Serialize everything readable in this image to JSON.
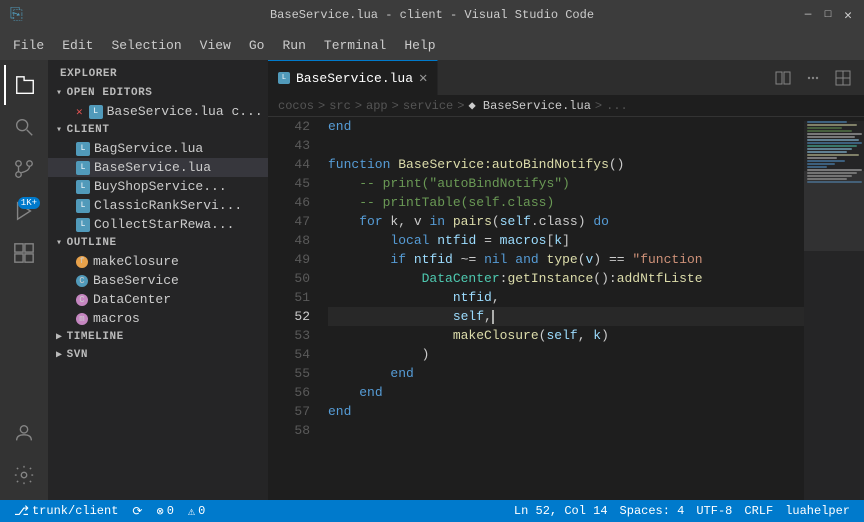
{
  "window": {
    "title": "BaseService.lua - client - Visual Studio Code"
  },
  "menu": {
    "items": [
      "File",
      "Edit",
      "Selection",
      "View",
      "Go",
      "Run",
      "Terminal",
      "Help"
    ]
  },
  "tabs": [
    {
      "label": "BaseService.lua",
      "active": true,
      "modified": false
    }
  ],
  "breadcrumb": {
    "parts": [
      "cocos",
      "src",
      "app",
      "service",
      "BaseService.lua",
      "..."
    ]
  },
  "sidebar": {
    "explorer_title": "EXPLORER",
    "open_editors": {
      "title": "OPEN EDITORS",
      "files": [
        "BaseService.lua  c..."
      ]
    },
    "client": {
      "title": "CLIENT",
      "files": [
        "BagService.lua",
        "BaseService.lua",
        "BuyShopService...",
        "ClassicRankServi...",
        "CollectStarRewa..."
      ]
    },
    "outline": {
      "title": "OUTLINE",
      "items": [
        {
          "name": "makeClosure",
          "type": "fn"
        },
        {
          "name": "BaseService",
          "type": "cls"
        },
        {
          "name": "DataCenter",
          "type": "cls"
        },
        {
          "name": "macros",
          "type": "var"
        }
      ]
    },
    "timeline": "TIMELINE",
    "svn": "SVN"
  },
  "code": {
    "lines": [
      {
        "num": 42,
        "content": "end",
        "tokens": [
          {
            "t": "kw",
            "v": "end"
          }
        ]
      },
      {
        "num": 43,
        "content": "",
        "tokens": []
      },
      {
        "num": 44,
        "content": "function BaseService:autoBindNotifys()",
        "tokens": [
          {
            "t": "kw",
            "v": "function"
          },
          {
            "t": "plain",
            "v": " "
          },
          {
            "t": "fn",
            "v": "BaseService:autoBindNotifys"
          },
          {
            "t": "punc",
            "v": "()"
          }
        ]
      },
      {
        "num": 45,
        "content": "    -- print(\"autoBindNotifys\")",
        "tokens": [
          {
            "t": "plain",
            "v": "    "
          },
          {
            "t": "cm",
            "v": "-- print(\"autoBindNotifys\")"
          }
        ]
      },
      {
        "num": 46,
        "content": "    -- printTable(self.class)",
        "tokens": [
          {
            "t": "plain",
            "v": "    "
          },
          {
            "t": "cm",
            "v": "-- printTable(self.class)"
          }
        ]
      },
      {
        "num": 47,
        "content": "    for k, v in pairs(self.class) do",
        "tokens": [
          {
            "t": "plain",
            "v": "    "
          },
          {
            "t": "kw",
            "v": "for"
          },
          {
            "t": "plain",
            "v": " k, v "
          },
          {
            "t": "kw",
            "v": "in"
          },
          {
            "t": "plain",
            "v": " "
          },
          {
            "t": "fn",
            "v": "pairs"
          },
          {
            "t": "punc",
            "v": "("
          },
          {
            "t": "var",
            "v": "self"
          },
          {
            "t": "plain",
            "v": ".class) "
          },
          {
            "t": "kw",
            "v": "do"
          }
        ]
      },
      {
        "num": 48,
        "content": "        local ntfid = macros[k]",
        "tokens": [
          {
            "t": "plain",
            "v": "        "
          },
          {
            "t": "kw",
            "v": "local"
          },
          {
            "t": "plain",
            "v": " "
          },
          {
            "t": "var",
            "v": "ntfid"
          },
          {
            "t": "plain",
            "v": " = "
          },
          {
            "t": "var",
            "v": "macros"
          },
          {
            "t": "punc",
            "v": "["
          },
          {
            "t": "var",
            "v": "k"
          },
          {
            "t": "punc",
            "v": "]"
          }
        ]
      },
      {
        "num": 49,
        "content": "        if ntfid ~= nil and type(v) == \"function\"",
        "tokens": [
          {
            "t": "plain",
            "v": "        "
          },
          {
            "t": "kw",
            "v": "if"
          },
          {
            "t": "plain",
            "v": " "
          },
          {
            "t": "var",
            "v": "ntfid"
          },
          {
            "t": "plain",
            "v": " ~= "
          },
          {
            "t": "kw",
            "v": "nil"
          },
          {
            "t": "plain",
            "v": " "
          },
          {
            "t": "kw",
            "v": "and"
          },
          {
            "t": "plain",
            "v": " "
          },
          {
            "t": "fn",
            "v": "type"
          },
          {
            "t": "punc",
            "v": "("
          },
          {
            "t": "var",
            "v": "v"
          },
          {
            "t": "punc",
            "v": ")"
          },
          {
            "t": "plain",
            "v": " == "
          },
          {
            "t": "str",
            "v": "\"function\""
          }
        ]
      },
      {
        "num": 50,
        "content": "            DataCenter:getInstance():addNtfListe",
        "tokens": [
          {
            "t": "plain",
            "v": "            "
          },
          {
            "t": "cls",
            "v": "DataCenter"
          },
          {
            "t": "plain",
            "v": ":"
          },
          {
            "t": "fn",
            "v": "getInstance"
          },
          {
            "t": "punc",
            "v": "()"
          },
          {
            "t": "plain",
            "v": ":"
          },
          {
            "t": "fn",
            "v": "addNtfListe"
          }
        ]
      },
      {
        "num": 51,
        "content": "                ntfid,",
        "tokens": [
          {
            "t": "plain",
            "v": "                "
          },
          {
            "t": "var",
            "v": "ntfid"
          },
          {
            "t": "punc",
            "v": ","
          }
        ]
      },
      {
        "num": 52,
        "content": "                self,",
        "tokens": [
          {
            "t": "plain",
            "v": "                "
          },
          {
            "t": "var",
            "v": "self"
          },
          {
            "t": "punc",
            "v": ","
          }
        ],
        "cursor": true
      },
      {
        "num": 53,
        "content": "                makeClosure(self, k)",
        "tokens": [
          {
            "t": "plain",
            "v": "                "
          },
          {
            "t": "fn",
            "v": "makeClosure"
          },
          {
            "t": "punc",
            "v": "("
          },
          {
            "t": "var",
            "v": "self"
          },
          {
            "t": "punc",
            "v": ", "
          },
          {
            "t": "var",
            "v": "k"
          },
          {
            "t": "punc",
            "v": ")"
          }
        ]
      },
      {
        "num": 54,
        "content": "            )",
        "tokens": [
          {
            "t": "plain",
            "v": "            "
          },
          {
            "t": "punc",
            "v": ")"
          }
        ]
      },
      {
        "num": 55,
        "content": "        end",
        "tokens": [
          {
            "t": "plain",
            "v": "        "
          },
          {
            "t": "kw",
            "v": "end"
          }
        ]
      },
      {
        "num": 56,
        "content": "    end",
        "tokens": [
          {
            "t": "plain",
            "v": "    "
          },
          {
            "t": "kw",
            "v": "end"
          }
        ]
      },
      {
        "num": 57,
        "content": "end",
        "tokens": [
          {
            "t": "kw",
            "v": "end"
          }
        ]
      },
      {
        "num": 58,
        "content": "",
        "tokens": []
      }
    ]
  },
  "status": {
    "branch": "trunk/client",
    "sync": "⟳",
    "errors": "⊗ 0",
    "warnings": "⚠ 0",
    "position": "Ln 52, Col 14",
    "spaces": "Spaces: 4",
    "encoding": "UTF-8",
    "eol": "CRLF",
    "language": "luahelper"
  }
}
